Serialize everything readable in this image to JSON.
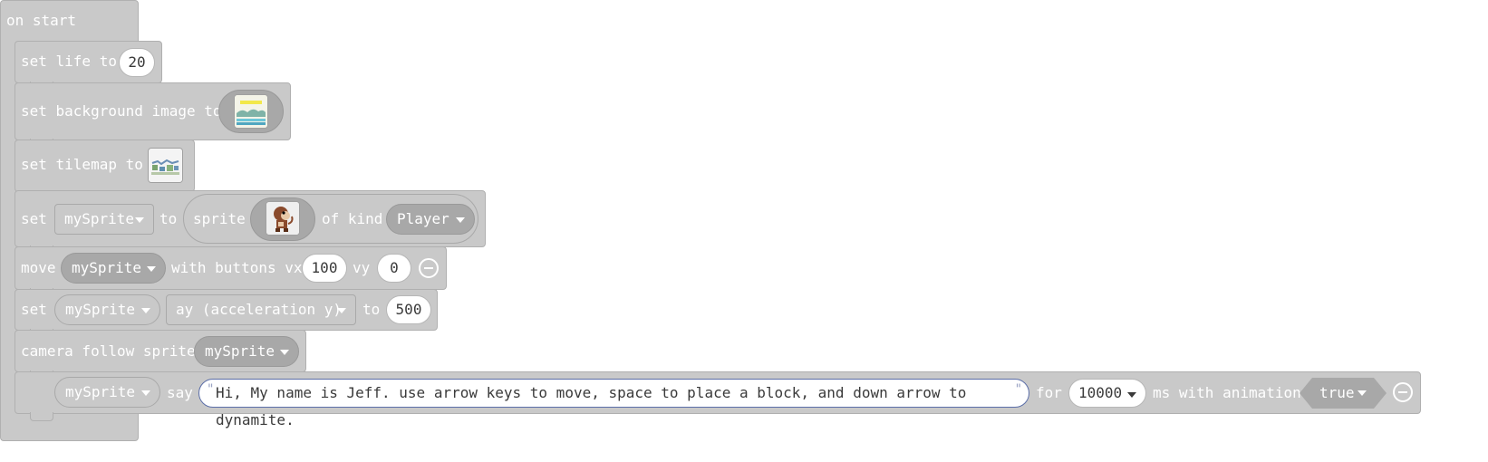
{
  "on_start": {
    "label": "on start"
  },
  "set_life": {
    "prefix": "set life to",
    "value": "20"
  },
  "set_background": {
    "prefix": "set background image to",
    "image_icon": "background-image-thumbnail"
  },
  "set_tilemap": {
    "prefix": "set tilemap to",
    "image_icon": "tilemap-thumbnail"
  },
  "set_sprite": {
    "set_label": "set",
    "variable": "mySprite",
    "to_label": "to",
    "sprite_label": "sprite",
    "sprite_icon": "monkey-sprite-thumbnail",
    "kind_label": "of kind",
    "kind": "Player"
  },
  "move": {
    "move_label": "move",
    "variable": "mySprite",
    "with_label": "with buttons vx",
    "vx": "100",
    "vy_label": "vy",
    "vy": "0"
  },
  "set_accel": {
    "set_label": "set",
    "variable": "mySprite",
    "property": "ay (acceleration y)",
    "to_label": "to",
    "value": "500"
  },
  "camera": {
    "label": "camera follow sprite",
    "variable": "mySprite"
  },
  "say": {
    "variable": "mySprite",
    "say_label": "say",
    "text": "Hi, My name is Jeff. use arrow keys to move, space to place a block, and down arrow to dynamite.",
    "quote_open": "\"",
    "quote_close": "\"",
    "for_label": "for",
    "duration": "10000",
    "ms_label": "ms with animation",
    "animation": "true"
  },
  "colors": {
    "block": "#c9c9c9",
    "dropdown_dark": "#a8a8a8",
    "field": "#ffffff",
    "string_border": "#5b6ea8"
  }
}
